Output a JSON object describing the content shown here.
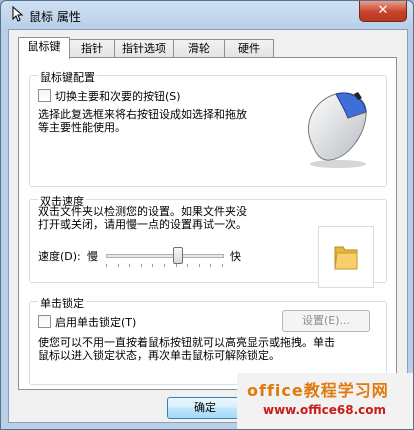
{
  "window": {
    "title": "鼠标 属性",
    "close_glyph": "✕"
  },
  "tabs": [
    "鼠标键",
    "指针",
    "指针选项",
    "滑轮",
    "硬件"
  ],
  "active_tab": "鼠标键",
  "button_config": {
    "title": "鼠标键配置",
    "switch_checkbox_label": "切换主要和次要的按钮(S)",
    "switch_checked": false,
    "desc_line1": "选择此复选框来将右按钮设成如选择和拖放",
    "desc_line2": "等主要性能使用。"
  },
  "double_click": {
    "title": "双击速度",
    "desc_line1": "双击文件夹以检测您的设置。如果文件夹没",
    "desc_line2": "打开或关闭，请用慢一点的设置再试一次。",
    "speed_label": "速度(D):",
    "slow_label": "慢",
    "fast_label": "快",
    "speed_value_fraction": 0.62
  },
  "click_lock": {
    "title": "单击锁定",
    "checkbox_label": "启用单击锁定(T)",
    "checked": false,
    "settings_button": "设置(E)...",
    "desc_line1": "使您可以不用一直按着鼠标按钮就可以高亮显示或拖拽。单击",
    "desc_line2": "鼠标以进入锁定状态，再次单击鼠标可解除锁定。"
  },
  "footer": {
    "ok_button": "确定"
  },
  "watermark": {
    "text": "office教程学习网",
    "url": "www.office68.com"
  },
  "colors": {
    "accent": "#2b6fd6",
    "folder": "#f0c050",
    "watermark_orange": "#e07a10",
    "watermark_red": "#cc1a1a"
  }
}
